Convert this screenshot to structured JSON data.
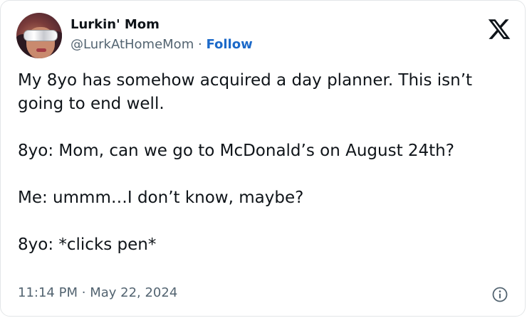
{
  "author": {
    "name": "Lurkin' Mom",
    "handle": "@LurkAtHomeMom",
    "separator": "·",
    "follow_label": "Follow"
  },
  "tweet": {
    "paragraphs": [
      "My 8yo has somehow acquired a day planner. This isn’t going to end well.",
      "8yo: Mom, can we go to McDonald’s on August 24th?",
      "Me: ummm…I don’t know, maybe?",
      "8yo: *clicks pen*"
    ],
    "time": "11:14 PM",
    "meta_separator": "·",
    "date": "May 22, 2024"
  },
  "icons": {
    "brand": "x-logo-icon",
    "info": "info-icon"
  },
  "colors": {
    "text": "#0f1419",
    "muted": "#536471",
    "follow": "#1d6ac9"
  }
}
